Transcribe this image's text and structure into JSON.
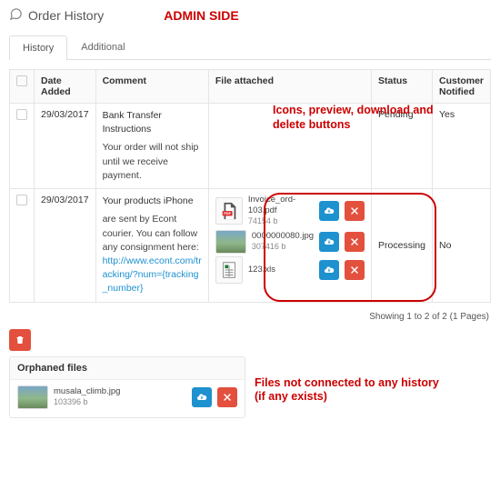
{
  "header": {
    "title": "Order History",
    "admin_label": "ADMIN SIDE"
  },
  "tabs": {
    "history": "History",
    "additional": "Additional"
  },
  "columns": {
    "date": "Date Added",
    "comment": "Comment",
    "file": "File attached",
    "status": "Status",
    "notified": "Customer Notified"
  },
  "rows": [
    {
      "date": "29/03/2017",
      "comment_title": "Bank Transfer Instructions",
      "comment_body": "Your order will not ship until we receive payment.",
      "status": "Pending",
      "notified": "Yes",
      "files": []
    },
    {
      "date": "29/03/2017",
      "comment_title": "Your products iPhone",
      "comment_body_pre": "are sent by Econt courier. You can follow any consignment here: ",
      "comment_link": "http://www.econt.com/tracking/?num={tracking_number}",
      "status": "Processing",
      "notified": "No",
      "files": [
        {
          "name": "Invoice_ord-103.pdf",
          "size": "74154 b",
          "icon": "pdf"
        },
        {
          "name": "0000000080.jpg",
          "size": "307416 b",
          "icon": "img"
        },
        {
          "name": "123.xls",
          "size": "",
          "icon": "xls"
        }
      ]
    }
  ],
  "callouts": {
    "files": "Icons, preview, download and delete buttons",
    "orphans": "Files not connected to any history (if any exists)"
  },
  "pager": "Showing 1 to 2 of 2 (1 Pages)",
  "orphans": {
    "title": "Orphaned files",
    "file": {
      "name": "musala_climb.jpg",
      "size": "103396 b"
    }
  }
}
